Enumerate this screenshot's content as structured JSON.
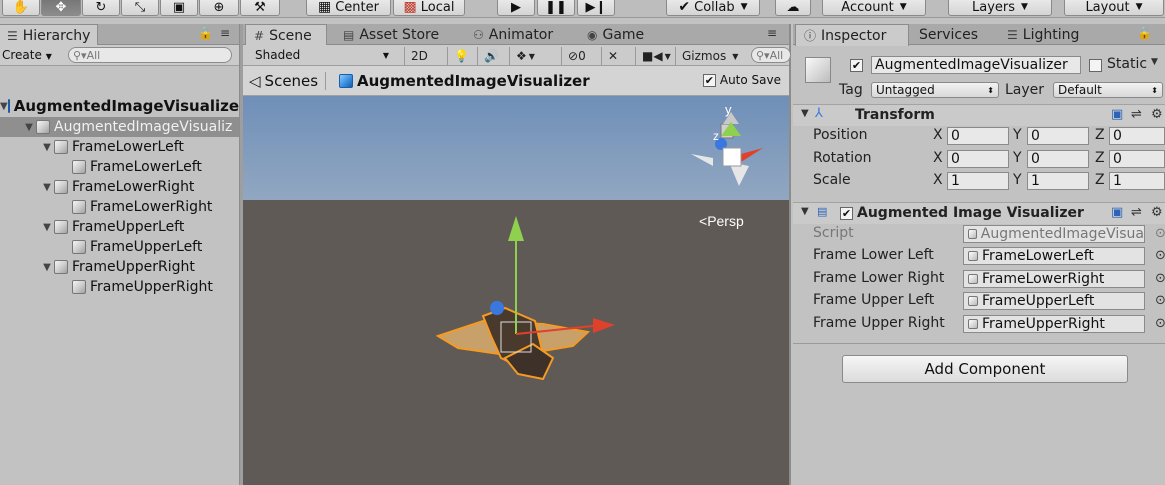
{
  "toolbar": {
    "hand_icon": "hand-icon",
    "center_label": "Center",
    "local_label": "Local",
    "collab_label": "Collab",
    "account_label": "Account",
    "layers_label": "Layers",
    "layout_label": "Layout"
  },
  "hierarchy": {
    "tab_label": "Hierarchy",
    "create_label": "Create",
    "search_placeholder": "All",
    "scene_name": "AugmentedImageVisualize",
    "items": [
      {
        "label": "AugmentedImageVisualiz"
      },
      {
        "label": "FrameLowerLeft"
      },
      {
        "label": "FrameLowerLeft"
      },
      {
        "label": "FrameLowerRight"
      },
      {
        "label": "FrameLowerRight"
      },
      {
        "label": "FrameUpperLeft"
      },
      {
        "label": "FrameUpperLeft"
      },
      {
        "label": "FrameUpperRight"
      },
      {
        "label": "FrameUpperRight"
      }
    ]
  },
  "scene": {
    "tabs": [
      "Scene",
      "Asset Store",
      "Animator",
      "Game"
    ],
    "shaded_label": "Shaded",
    "mode_2d": "2D",
    "hidden_count": "0",
    "gizmos_label": "Gizmos",
    "search_placeholder": "All",
    "breadcrumb_scenes": "Scenes",
    "breadcrumb_object": "AugmentedImageVisualizer",
    "auto_save_label": "Auto Save",
    "gizmo_axis_y": "y",
    "gizmo_axis_z": "z",
    "persp_label": "Persp"
  },
  "inspector": {
    "tabs": [
      "Inspector",
      "Services",
      "Lighting"
    ],
    "object_name": "AugmentedImageVisualizer",
    "static_label": "Static",
    "tag_label": "Tag",
    "tag_value": "Untagged",
    "layer_label": "Layer",
    "layer_value": "Default",
    "transform": {
      "title": "Transform",
      "rows": [
        {
          "label": "Position",
          "x": "0",
          "y": "0",
          "z": "0"
        },
        {
          "label": "Rotation",
          "x": "0",
          "y": "0",
          "z": "0"
        },
        {
          "label": "Scale",
          "x": "1",
          "y": "1",
          "z": "1"
        }
      ],
      "axis_x": "X",
      "axis_y": "Y",
      "axis_z": "Z"
    },
    "component": {
      "title": "Augmented Image Visualizer",
      "script_label": "Script",
      "script_value": "AugmentedImageVisua",
      "fields": [
        {
          "label": "Frame Lower Left",
          "value": "FrameLowerLeft"
        },
        {
          "label": "Frame Lower Right",
          "value": "FrameLowerRight"
        },
        {
          "label": "Frame Upper Left",
          "value": "FrameUpperLeft"
        },
        {
          "label": "Frame Upper Right",
          "value": "FrameUpperRight"
        }
      ]
    },
    "add_component_label": "Add Component"
  },
  "colors": {
    "panel_bg": "#c2c2c2",
    "selection": "#8f8f8f",
    "gizmo_y": "#8fd14f",
    "gizmo_x": "#e0412b",
    "gizmo_z": "#3a78e0",
    "outline": "#f59a23"
  }
}
